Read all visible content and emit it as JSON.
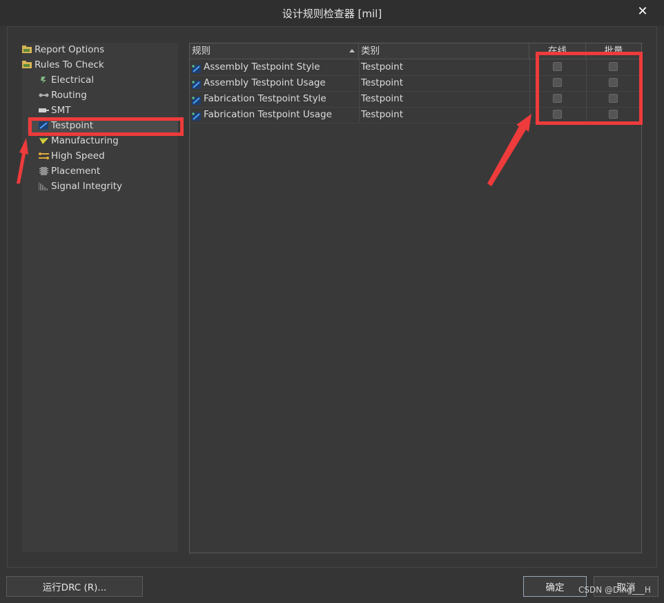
{
  "window": {
    "title": "设计规则检查器 [mil]",
    "close_glyph": "✕"
  },
  "tree": {
    "items": [
      {
        "label": "Report Options",
        "icon": "folder-icon",
        "indent": 0
      },
      {
        "label": "Rules To Check",
        "icon": "folder-icon",
        "indent": 0
      },
      {
        "label": "Electrical",
        "icon": "electrical-icon",
        "indent": 1
      },
      {
        "label": "Routing",
        "icon": "routing-icon",
        "indent": 1
      },
      {
        "label": "SMT",
        "icon": "smt-icon",
        "indent": 1
      },
      {
        "label": "Testpoint",
        "icon": "testpoint-icon",
        "indent": 1,
        "selected": true
      },
      {
        "label": "Manufacturing",
        "icon": "manufacturing-icon",
        "indent": 1
      },
      {
        "label": "High Speed",
        "icon": "high-speed-icon",
        "indent": 1
      },
      {
        "label": "Placement",
        "icon": "placement-icon",
        "indent": 1
      },
      {
        "label": "Signal Integrity",
        "icon": "signal-integrity-icon",
        "indent": 1
      }
    ]
  },
  "table": {
    "columns": {
      "rule": "规则",
      "category": "类别",
      "online": "在线",
      "batch": "批量"
    },
    "rows": [
      {
        "rule": "Assembly Testpoint Style",
        "category": "Testpoint",
        "online": false,
        "batch": false
      },
      {
        "rule": "Assembly Testpoint Usage",
        "category": "Testpoint",
        "online": false,
        "batch": false
      },
      {
        "rule": "Fabrication Testpoint Style",
        "category": "Testpoint",
        "online": false,
        "batch": false
      },
      {
        "rule": "Fabrication Testpoint Usage",
        "category": "Testpoint",
        "online": false,
        "batch": false
      }
    ]
  },
  "buttons": {
    "run_drc": "运行DRC (R)...",
    "ok": "确定",
    "cancel": "取消"
  },
  "watermark": "CSDN @Ding___H",
  "colors": {
    "annotation_red": "#ee3b3b",
    "background": "#353535",
    "selected_row": "#4b4b4b"
  }
}
